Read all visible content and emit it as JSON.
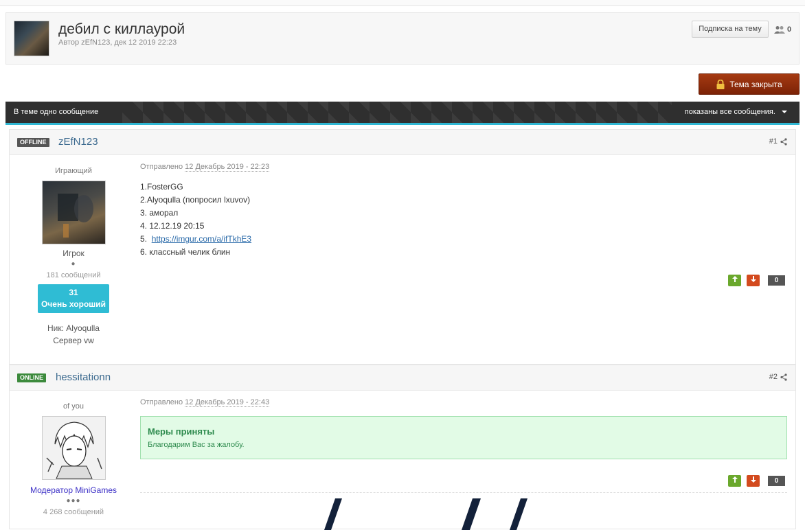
{
  "topic": {
    "title": "дебил с киллаурой",
    "meta": "Автор zEfN123, дек 12 2019 22:23",
    "follow_label": "Подписка на тему",
    "followers_count": "0",
    "closed_label": "Тема закрыта"
  },
  "bar": {
    "left_text": "В теме одно сообщение",
    "right_text": "показаны все сообщения."
  },
  "posts": [
    {
      "status": "OFFLINE",
      "author": "zEfN123",
      "number": "#1",
      "user_title": "Играющий",
      "group": "Игрок",
      "pips": "●",
      "post_count": "181 сообщений",
      "rep_value": "31",
      "rep_label": "Очень хороший",
      "info_lines": [
        "Ник: Alyoqulla",
        "Сервер vw"
      ],
      "posted_prefix": "Отправлено",
      "posted_date": "12 Декабрь 2019 - 22:23",
      "lines": [
        "1.FosterGG",
        "2.Alyoqulla (попросил lxuvov)",
        "3. аморал",
        "4. 12.12.19 20:15"
      ],
      "link_prefix": "5.",
      "link": "https://imgur.com/a/ifTkhE3",
      "last_line": "6. классный челик блин",
      "score": "0"
    },
    {
      "status": "ONLINE",
      "author": "hessitationn",
      "number": "#2",
      "user_title": "of you",
      "group": "Модератор MiniGames",
      "pips": "●●●",
      "post_count": "4 268 сообщений",
      "posted_prefix": "Отправлено",
      "posted_date": "12 Декабрь 2019 - 22:43",
      "notice_title": "Меры приняты",
      "notice_text": "Благодарим Вас за жалобу.",
      "score": "0"
    }
  ],
  "icons": {
    "share": "share-icon",
    "lock": "lock-icon",
    "caret": "caret-down-icon",
    "people": "people-icon",
    "up": "arrow-up-icon",
    "down": "arrow-down-icon"
  },
  "colors": {
    "accent": "#2fb7d3",
    "closed_button": "#8f2c0b",
    "vote_up": "#6aa82c",
    "vote_down": "#d34a1e",
    "notice_bg": "#e2fbe6",
    "notice_text": "#2e8b4e",
    "moderator": "#3b2fc6"
  }
}
